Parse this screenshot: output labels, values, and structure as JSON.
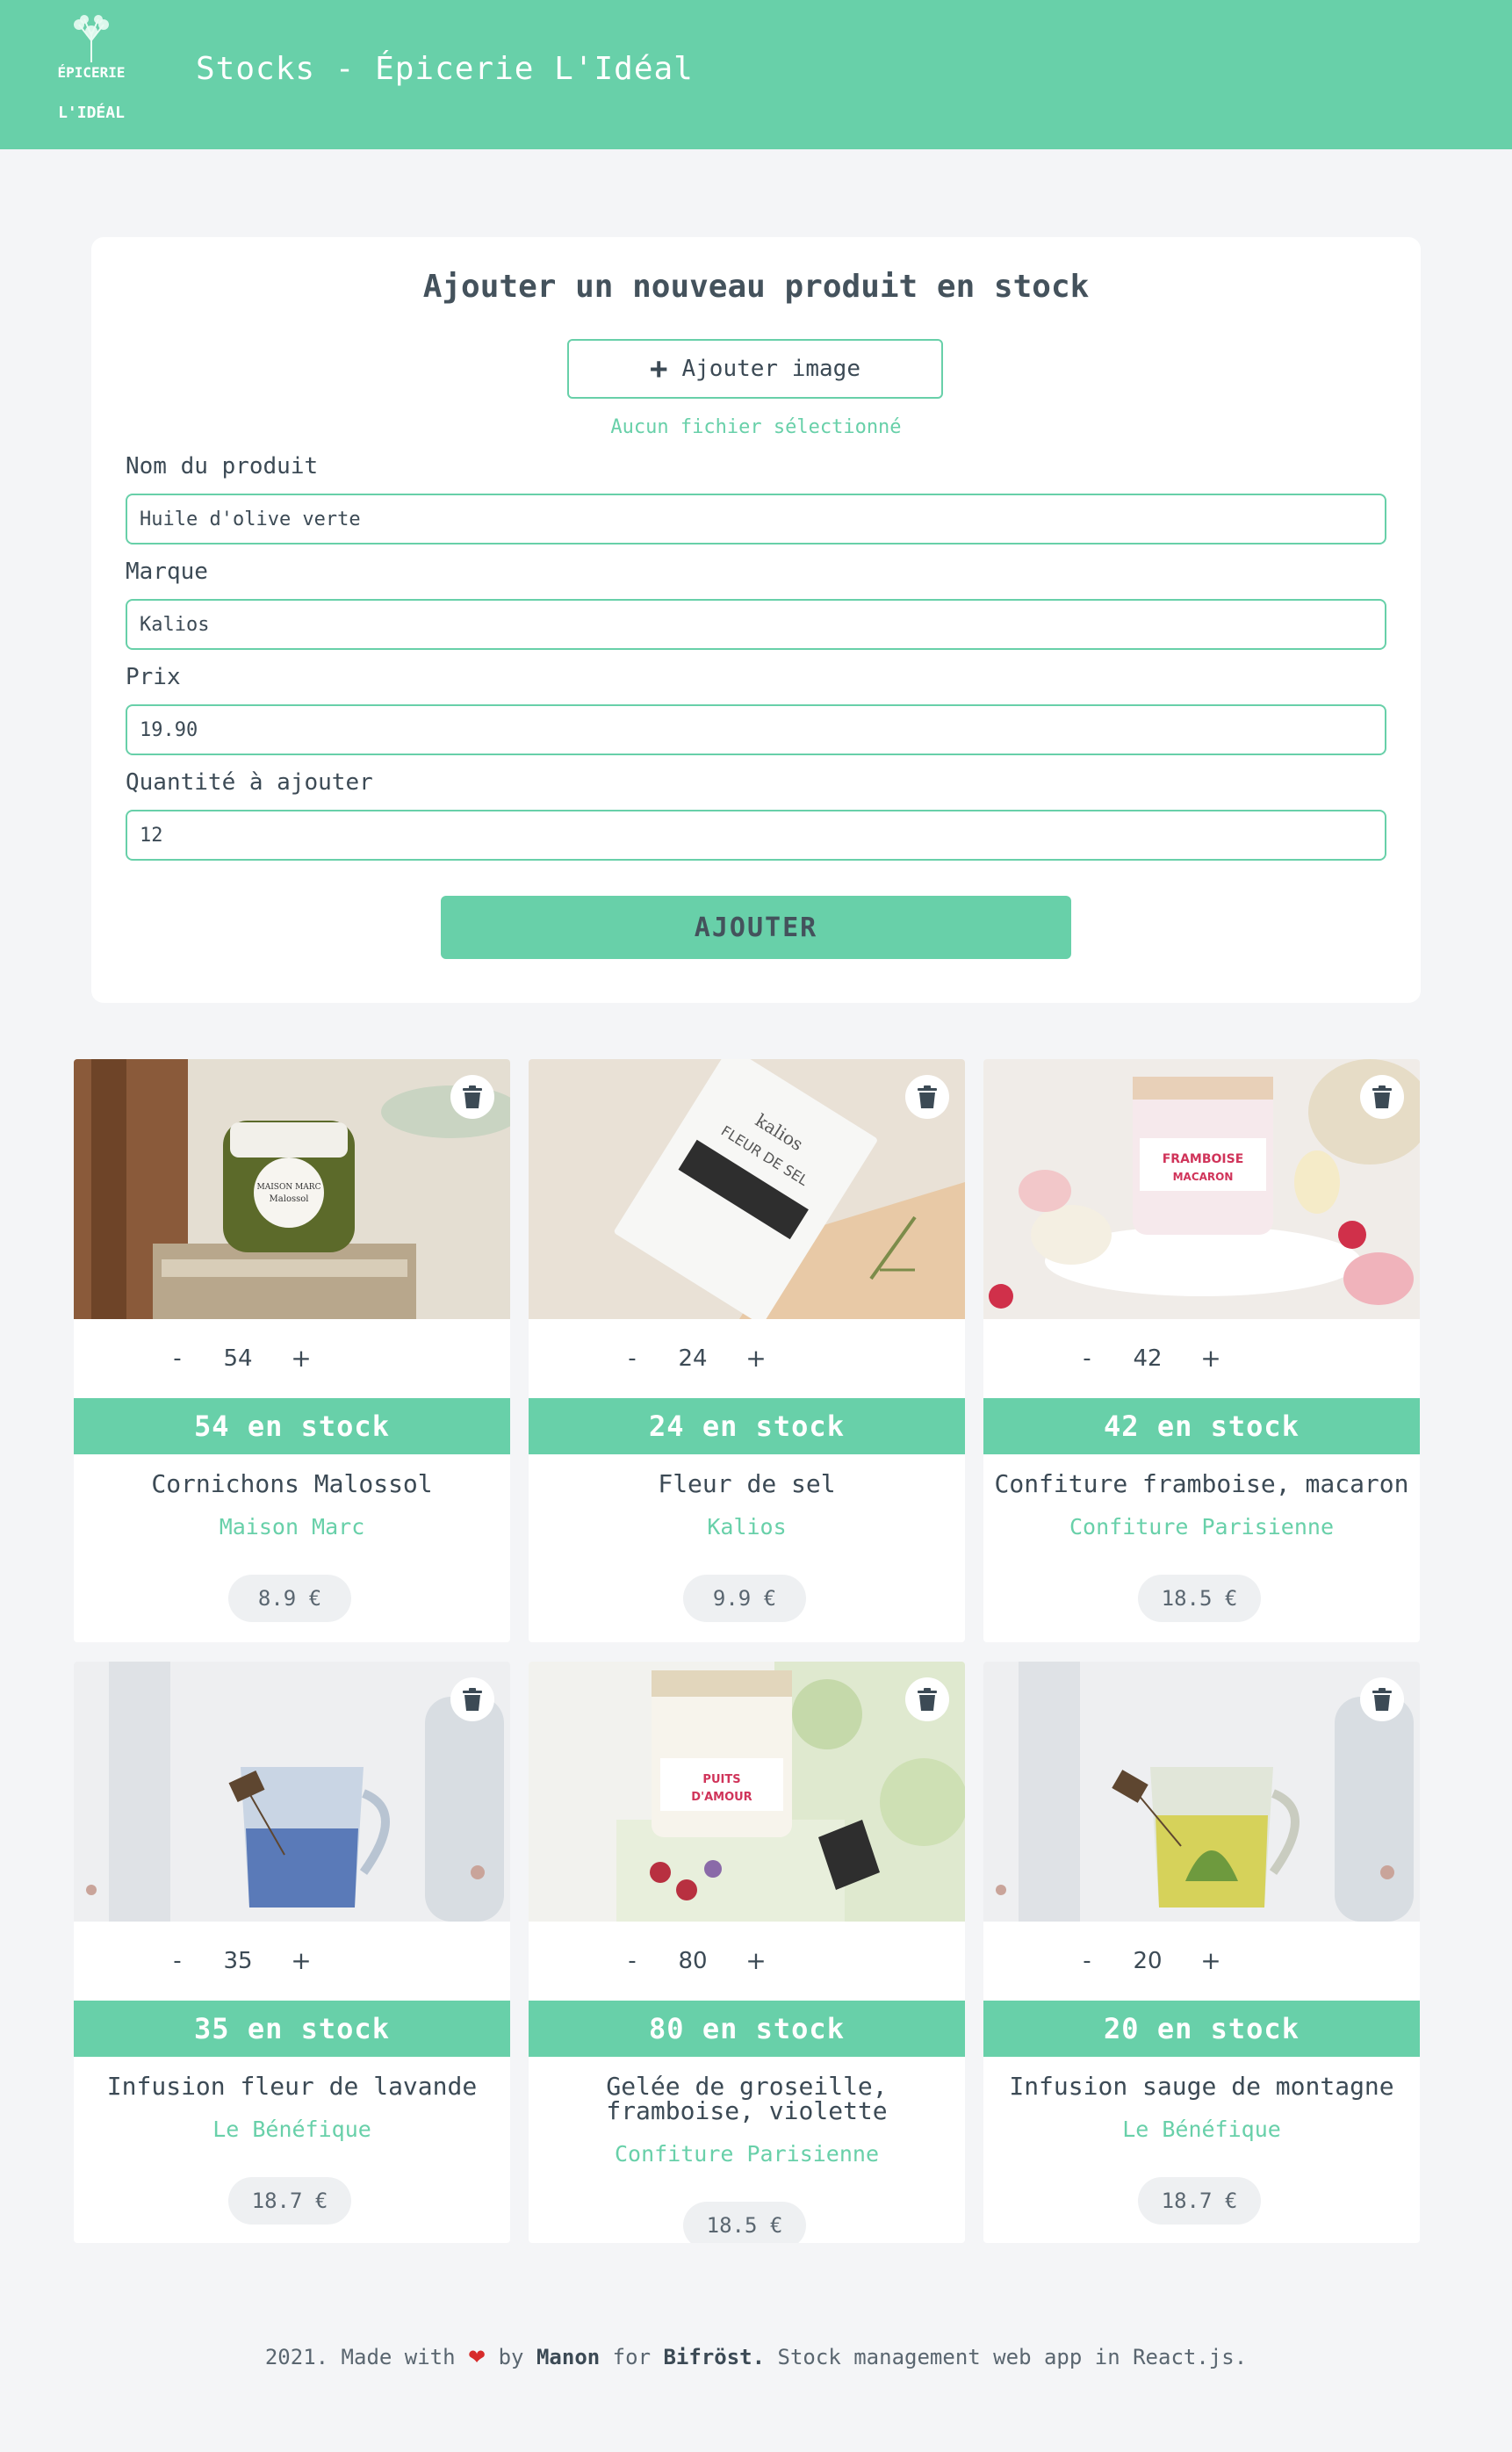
{
  "header": {
    "title": "Stocks - Épicerie L'Idéal",
    "logo_line1": "ÉPICERIE",
    "logo_line2": "L'IDÉAL"
  },
  "form": {
    "title": "Ajouter un nouveau produit en stock",
    "add_image_label": "Ajouter image",
    "no_file_text": "Aucun fichier sélectionné",
    "fields": [
      {
        "label": "Nom du produit",
        "value": "Huile d'olive verte"
      },
      {
        "label": "Marque",
        "value": "Kalios"
      },
      {
        "label": "Prix",
        "value": "19.90"
      },
      {
        "label": "Quantité à ajouter",
        "value": "12"
      }
    ],
    "submit_label": "AJOUTER"
  },
  "products": [
    {
      "qty": "54",
      "stock": "54 en stock",
      "name": "Cornichons Malossol",
      "brand": "Maison Marc",
      "price": "8.9 €",
      "image_label": "MAISON MARC Malossol"
    },
    {
      "qty": "24",
      "stock": "24 en stock",
      "name": "Fleur de sel",
      "brand": "Kalios",
      "price": "9.9 €",
      "image_label": "kalios FLEUR DE SEL"
    },
    {
      "qty": "42",
      "stock": "42 en stock",
      "name": "Confiture framboise, macaron",
      "brand": "Confiture Parisienne",
      "price": "18.5 €",
      "image_label": "FRAMBOISE MACARON"
    },
    {
      "qty": "35",
      "stock": "35 en stock",
      "name": "Infusion fleur de lavande",
      "brand": "Le Bénéfique",
      "price": "18.7 €"
    },
    {
      "qty": "80",
      "stock": "80 en stock",
      "name": "Gelée de groseille, framboise, violette",
      "brand": "Confiture Parisienne",
      "price": "18.5 €",
      "image_label": "PUITS D'AMOUR"
    },
    {
      "qty": "20",
      "stock": "20 en stock",
      "name": "Infusion sauge de montagne",
      "brand": "Le Bénéfique",
      "price": "18.7 €"
    }
  ],
  "controls": {
    "minus": "-",
    "plus": "+"
  },
  "footer": {
    "year": "2021. Made with",
    "heart": "❤",
    "by": "by",
    "author": "Manon",
    "for": "for",
    "company": "Bifröst.",
    "tagline": "Stock management web app in React.js."
  },
  "colors": {
    "accent": "#68d0a9",
    "background": "#f4f5f7",
    "text": "#3c4a55",
    "heart": "#d72b2b"
  }
}
